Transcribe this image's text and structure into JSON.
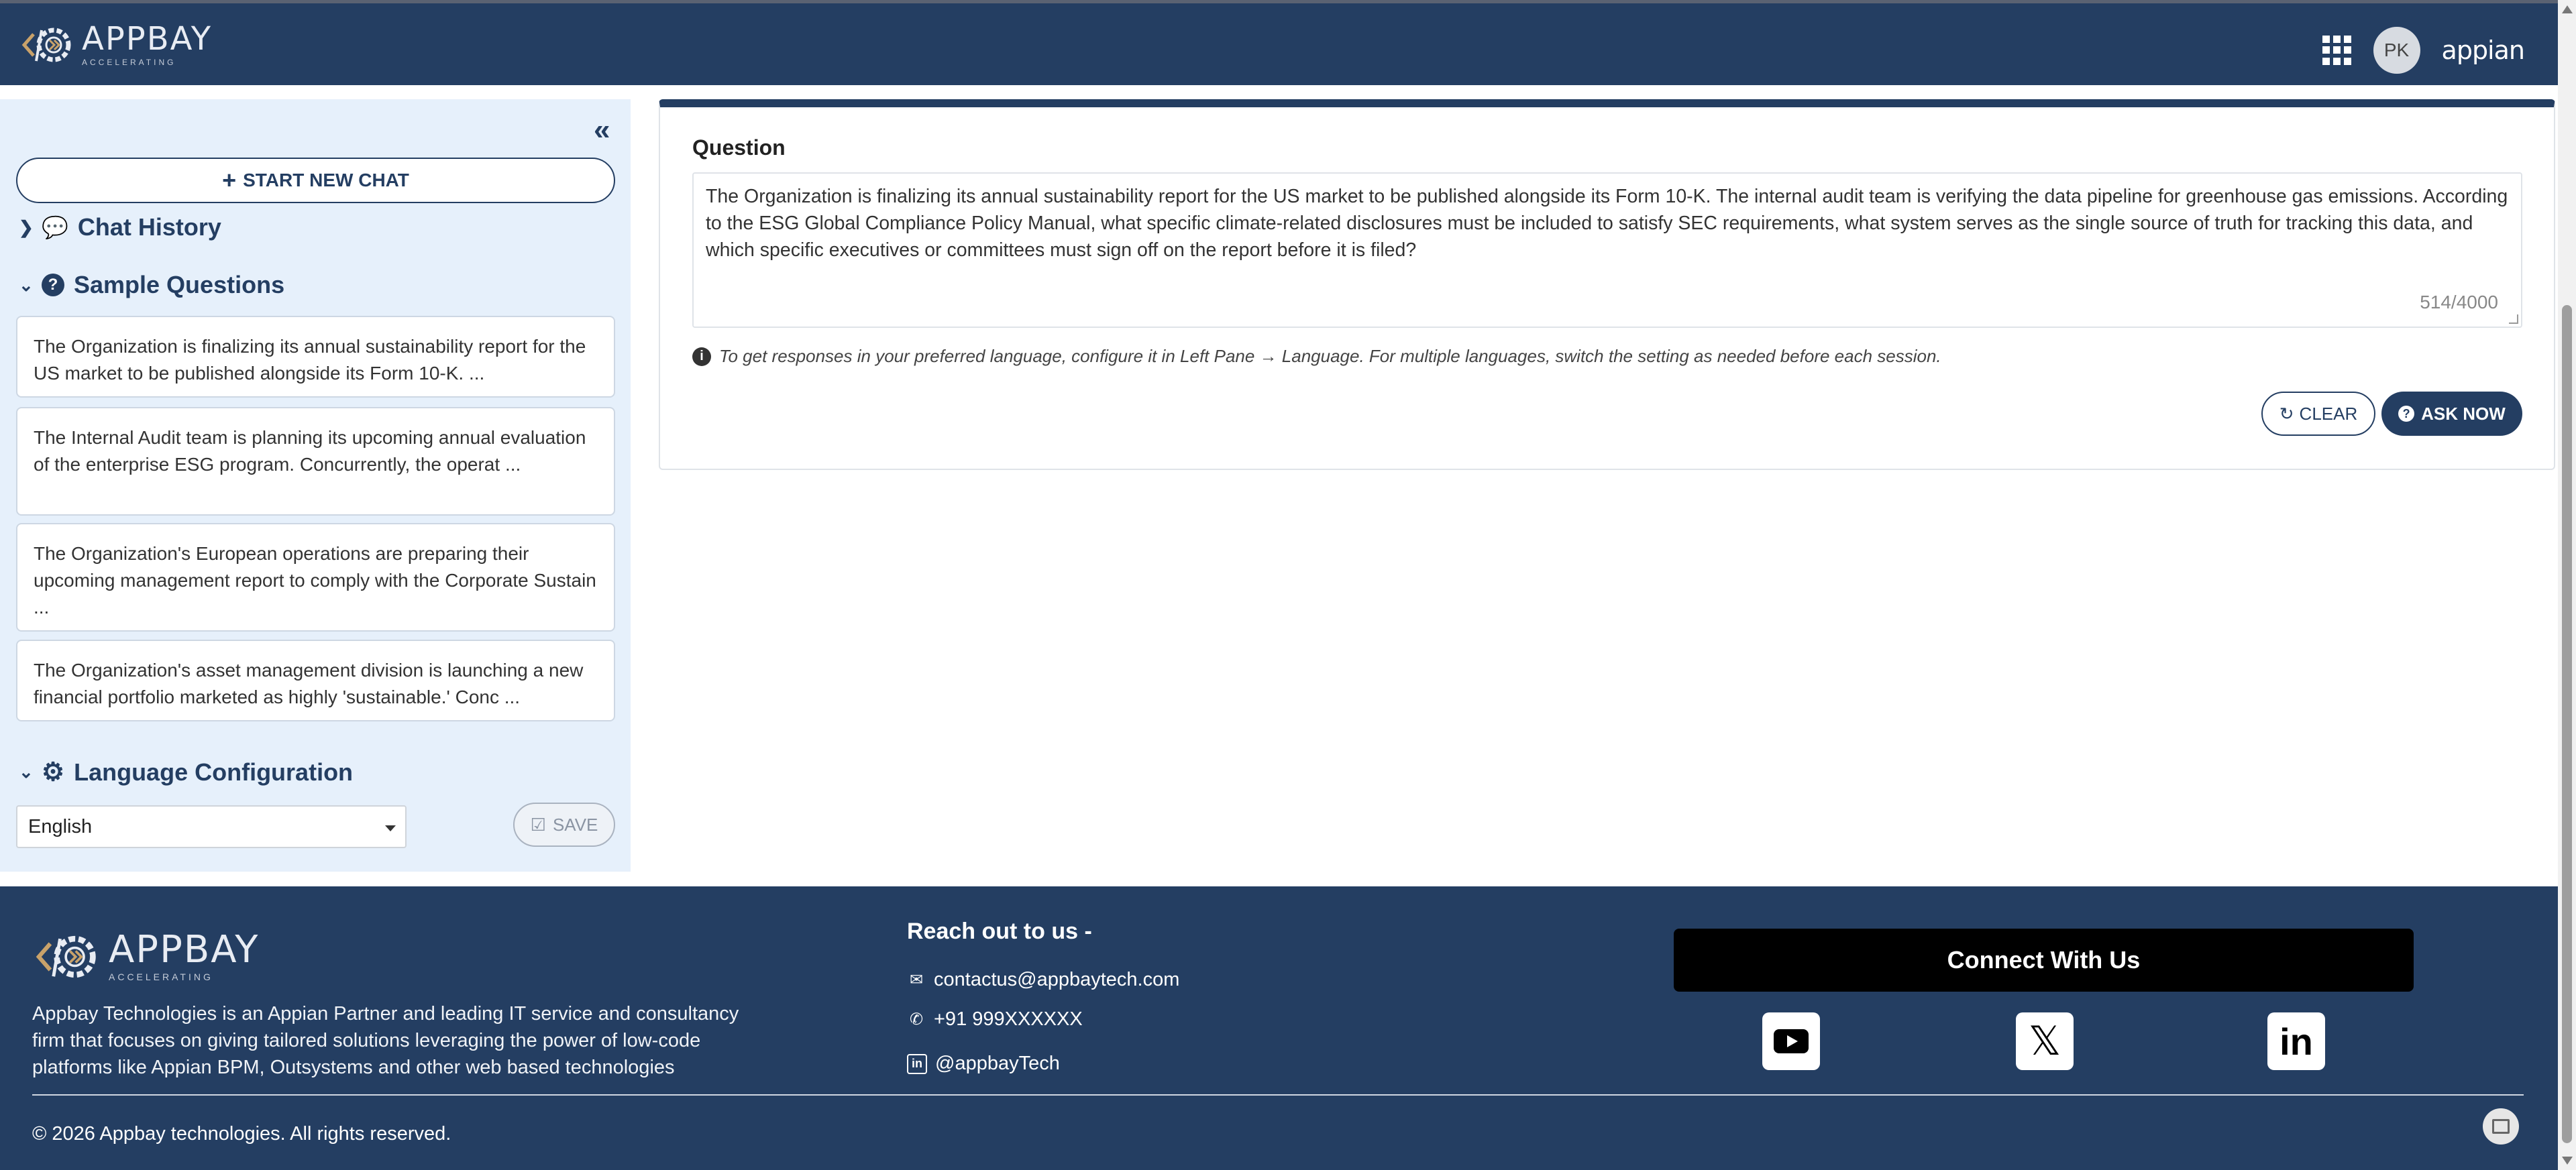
{
  "header": {
    "logo_word": "APPBAY",
    "logo_sub": "ACCELERATING",
    "avatar_initials": "PK",
    "brand": "appian"
  },
  "sidebar": {
    "collapse": "«",
    "new_chat_label": "START NEW CHAT",
    "chat_history_label": "Chat History",
    "sample_questions_label": "Sample Questions",
    "sample_questions": [
      "The Organization is finalizing its annual sustainability report for the US market to be published alongside its Form 10-K. ...",
      "The Internal Audit team is planning its upcoming annual evaluation of the enterprise ESG program. Concurrently, the operat ...",
      "The Organization's European operations are preparing their upcoming management report to comply with the Corporate Sustain ...",
      "The Organization's asset management division is launching a new financial portfolio marketed as highly 'sustainable.' Conc ..."
    ],
    "language_config_label": "Language Configuration",
    "language_value": "English",
    "save_label": "SAVE"
  },
  "main": {
    "question_label": "Question",
    "question_text": "The Organization is finalizing its annual sustainability report for the US market to be published alongside its Form 10-K. The internal audit team is verifying the data pipeline for greenhouse gas emissions. According to the ESG Global Compliance Policy Manual, what specific climate-related disclosures must be included to satisfy SEC requirements, what system serves as the single source of truth for tracking this data, and which specific executives or committees must sign off on the report before it is filed?",
    "counter": "514/4000",
    "info_text": "To get responses in your preferred language, configure it in Left Pane → Language. For multiple languages, switch the setting as needed before each session.",
    "clear_label": "CLEAR",
    "ask_label": "ASK NOW"
  },
  "footer": {
    "logo_word": "APPBAY",
    "logo_sub": "ACCELERATING",
    "description": "Appbay Technologies is an Appian Partner and leading IT service and consultancy firm that focuses on giving tailored solutions leveraging the power of low-code platforms like Appian BPM, Outsystems and other web based technologies",
    "reach_title": "Reach out to us -",
    "email": "contactus@appbaytech.com",
    "phone": "+91 999XXXXXX",
    "linkedin_handle": "@appbayTech",
    "connect_title": "Connect With Us",
    "copyright": "© 2026 Appbay technologies. All rights reserved."
  },
  "colors": {
    "primary": "#243e62",
    "sidebar_bg": "#e6f0fb",
    "connect_bg": "#000000"
  }
}
